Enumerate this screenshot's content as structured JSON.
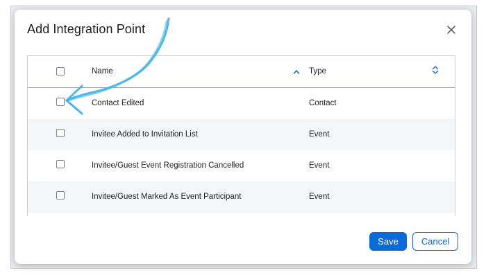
{
  "modal": {
    "title": "Add Integration Point",
    "close_icon": "close-icon"
  },
  "table": {
    "columns": [
      {
        "label": "Name",
        "sort_icon": "sort-ascending-icon",
        "sort_state": "ascending"
      },
      {
        "label": "Type",
        "sort_icon": "sort-both-icon",
        "sort_state": "unsorted"
      }
    ],
    "rows": [
      {
        "name": "Contact Edited",
        "type": "Contact",
        "checked": false
      },
      {
        "name": "Invitee Added to Invitation List",
        "type": "Event",
        "checked": false
      },
      {
        "name": "Invitee/Guest Event Registration Cancelled",
        "type": "Event",
        "checked": false
      },
      {
        "name": "Invitee/Guest Marked As Event Participant",
        "type": "Event",
        "checked": false
      }
    ]
  },
  "footer": {
    "save_label": "Save",
    "cancel_label": "Cancel"
  },
  "annotation": {
    "arrow_icon": "hand-drawn-arrow-icon",
    "color": "#3db3e3"
  },
  "colors": {
    "primary": "#0a6bd8",
    "row_alt": "#f4f5f6"
  }
}
